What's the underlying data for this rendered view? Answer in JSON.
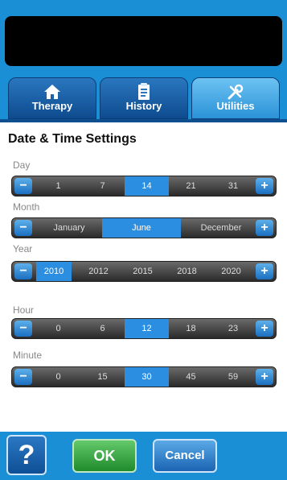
{
  "tabs": [
    {
      "label": "Therapy",
      "icon": "home-icon"
    },
    {
      "label": "History",
      "icon": "clipboard-icon"
    },
    {
      "label": "Utilities",
      "icon": "tools-icon"
    }
  ],
  "active_tab": "Utilities",
  "page_title": "Date & Time Settings",
  "settings": {
    "day": {
      "label": "Day",
      "options": [
        "1",
        "7",
        "14",
        "21",
        "31"
      ],
      "selected": "14"
    },
    "month": {
      "label": "Month",
      "options": [
        "January",
        "June",
        "December"
      ],
      "selected": "June"
    },
    "year": {
      "label": "Year",
      "options": [
        "2010",
        "2012",
        "2015",
        "2018",
        "2020"
      ],
      "selected": "2010"
    },
    "hour": {
      "label": "Hour",
      "options": [
        "0",
        "6",
        "12",
        "18",
        "23"
      ],
      "selected": "12"
    },
    "minute": {
      "label": "Minute",
      "options": [
        "0",
        "15",
        "30",
        "45",
        "59"
      ],
      "selected": "30"
    }
  },
  "stepper": {
    "minus": "−",
    "plus": "+"
  },
  "footer": {
    "help_label": "?",
    "ok_label": "OK",
    "cancel_label": "Cancel"
  },
  "colors": {
    "accent": "#1a8fd6",
    "ok": "#2e9e3a",
    "selected": "#2b8ee0"
  }
}
